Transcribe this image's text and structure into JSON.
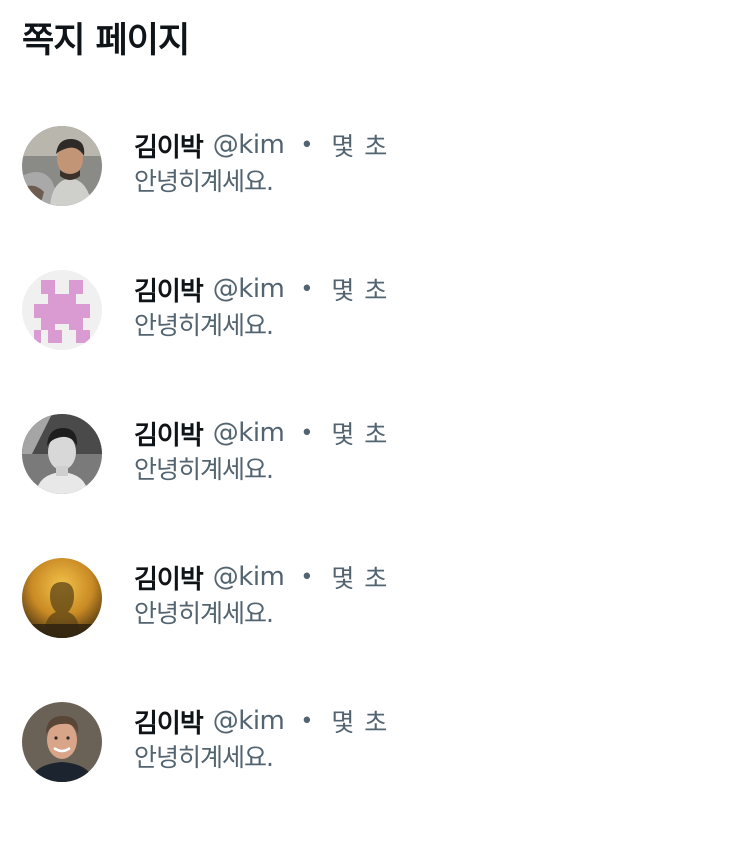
{
  "page": {
    "title": "쪽지 페이지"
  },
  "messages": [
    {
      "name": "김이박",
      "handle": "@kim",
      "separator": "•",
      "time": "몇 초",
      "text": "안녕히계세요.",
      "avatar": "avatar-photo-man-hoodie"
    },
    {
      "name": "김이박",
      "handle": "@kim",
      "separator": "•",
      "time": "몇 초",
      "text": "안녕히계세요.",
      "avatar": "avatar-identicon-pink"
    },
    {
      "name": "김이박",
      "handle": "@kim",
      "separator": "•",
      "time": "몇 초",
      "text": "안녕히계세요.",
      "avatar": "avatar-photo-bw-man"
    },
    {
      "name": "김이박",
      "handle": "@kim",
      "separator": "•",
      "time": "몇 초",
      "text": "안녕히계세요.",
      "avatar": "avatar-photo-silhouette"
    },
    {
      "name": "김이박",
      "handle": "@kim",
      "separator": "•",
      "time": "몇 초",
      "text": "안녕히계세요.",
      "avatar": "avatar-photo-smiling-man"
    }
  ],
  "colors": {
    "primary_text": "#0f1419",
    "secondary_text": "#536471",
    "background": "#ffffff",
    "identicon_pink": "#d99bd1"
  }
}
